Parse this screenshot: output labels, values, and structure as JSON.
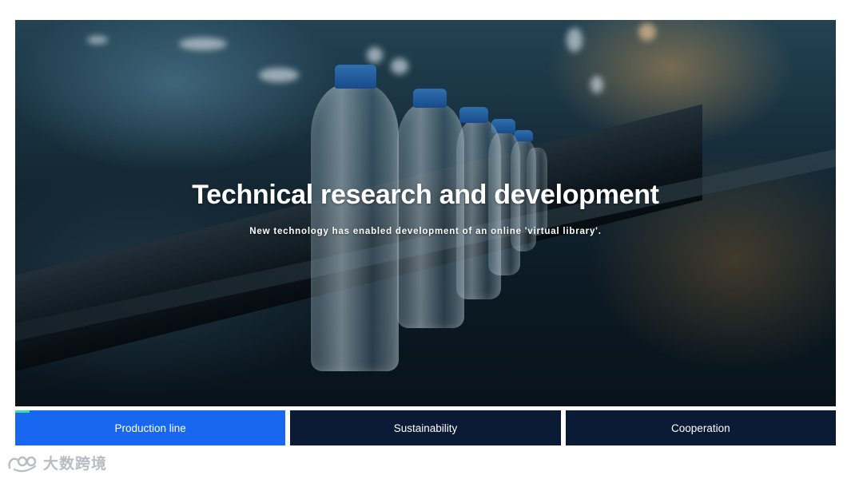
{
  "hero": {
    "title": "Technical research and development",
    "subtitle": "New technology has enabled development of an online 'virtual library'.",
    "image_subject": "water-bottle-production-line"
  },
  "tabs": [
    {
      "label": "Production line",
      "active": true
    },
    {
      "label": "Sustainability",
      "active": false
    },
    {
      "label": "Cooperation",
      "active": false
    }
  ],
  "watermark": {
    "text": "大数跨境",
    "icon": "brand-logo-icon"
  },
  "colors": {
    "active_tab": "#1867f0",
    "inactive_tab": "#0b1a35",
    "active_marker": "#3ddc9a",
    "bottle_cap": "#2f7fd6",
    "watermark": "#b8bcc3"
  }
}
